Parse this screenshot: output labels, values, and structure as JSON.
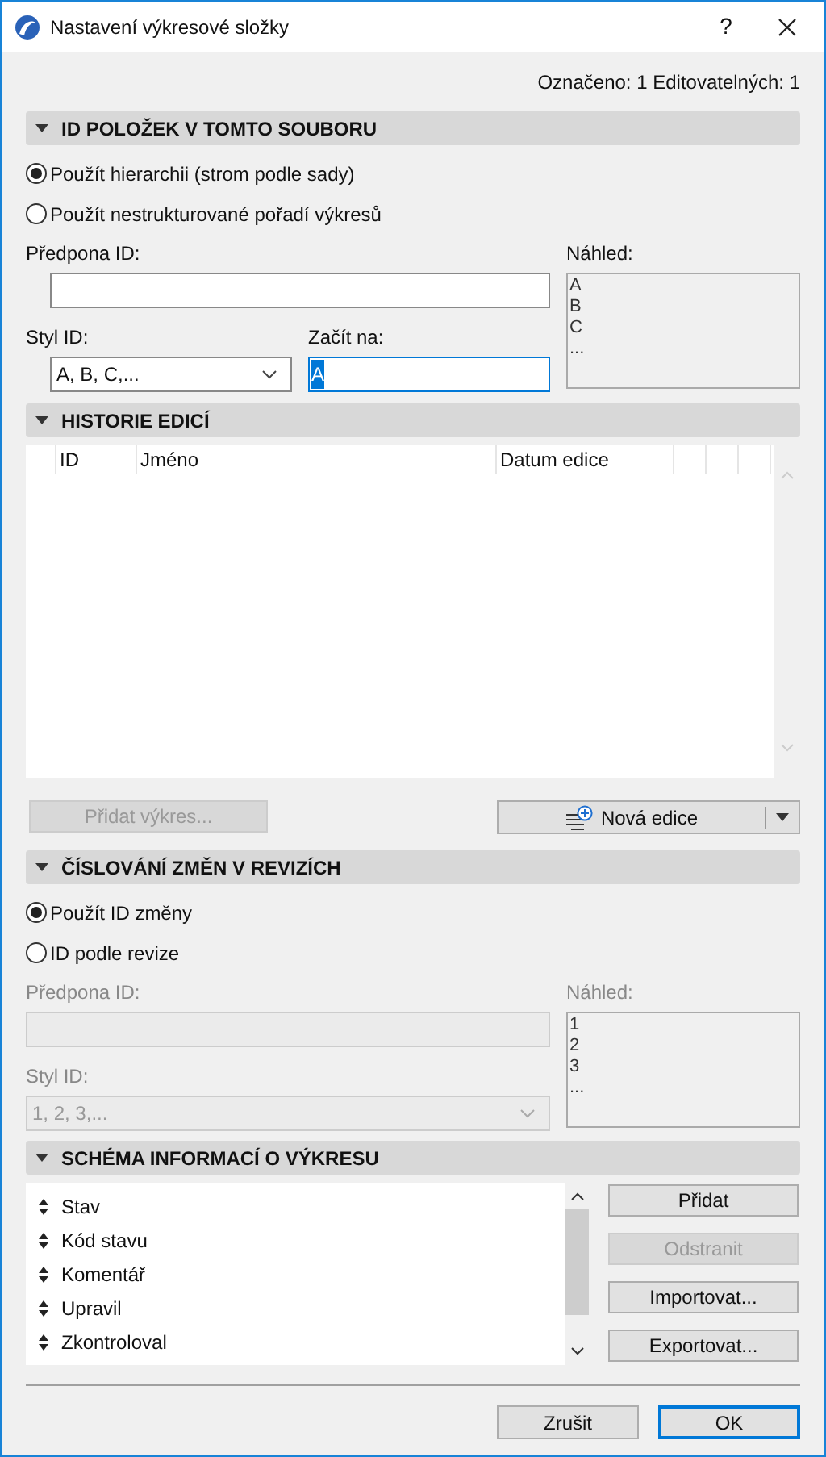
{
  "window": {
    "title": "Nastavení výkresové složky",
    "help": "?"
  },
  "status": "Označeno: 1 Editovatelných: 1",
  "id_section": {
    "title": "ID POLOŽEK V TOMTO SOUBORU",
    "expanded": true,
    "options": [
      {
        "label": "Použít hierarchii (strom podle sady)",
        "selected": true
      },
      {
        "label": "Použít nestrukturované pořadí výkresů",
        "selected": false
      }
    ],
    "prefix": {
      "label": "Předpona ID:",
      "disabled": false
    },
    "preview": {
      "label": "Náhled:",
      "lines": [
        "A",
        "B",
        "C",
        "..."
      ]
    },
    "style": {
      "label": "Styl ID:",
      "value": "A, B, C,...",
      "disabled": false
    },
    "start": {
      "label": "Začít na:",
      "value": "A"
    }
  },
  "history_section": {
    "title": "HISTORIE EDICÍ",
    "expanded": true,
    "columns": [
      "ID",
      "Jméno",
      "Datum edice"
    ],
    "add_button": {
      "label": "Přidat výkres...",
      "disabled": true
    },
    "new_button": {
      "label": "Nová edice",
      "disabled": false
    }
  },
  "revision_section": {
    "title": "ČÍSLOVÁNÍ ZMĚN V REVIZÍCH",
    "expanded": true,
    "options": [
      {
        "label": "Použít ID změny",
        "selected": true
      },
      {
        "label": "ID podle revize",
        "selected": false
      }
    ],
    "prefix": {
      "label": "Předpona ID:",
      "disabled": true
    },
    "preview": {
      "label": "Náhled:",
      "lines": [
        "1",
        "2",
        "3",
        "..."
      ]
    },
    "style": {
      "label": "Styl ID:",
      "value": "1, 2, 3,...",
      "disabled": true
    }
  },
  "schema_section": {
    "title": "SCHÉMA INFORMACÍ O VÝKRESU",
    "expanded": true,
    "items": [
      "Stav",
      "Kód stavu",
      "Komentář",
      "Upravil",
      "Zkontroloval"
    ],
    "buttons": [
      {
        "label": "Přidat",
        "disabled": false
      },
      {
        "label": "Odstranit",
        "disabled": true
      },
      {
        "label": "Importovat...",
        "disabled": false
      },
      {
        "label": "Exportovat...",
        "disabled": false
      }
    ]
  },
  "footer": [
    {
      "label": "Zrušit",
      "default": false
    },
    {
      "label": "OK",
      "default": true
    }
  ]
}
